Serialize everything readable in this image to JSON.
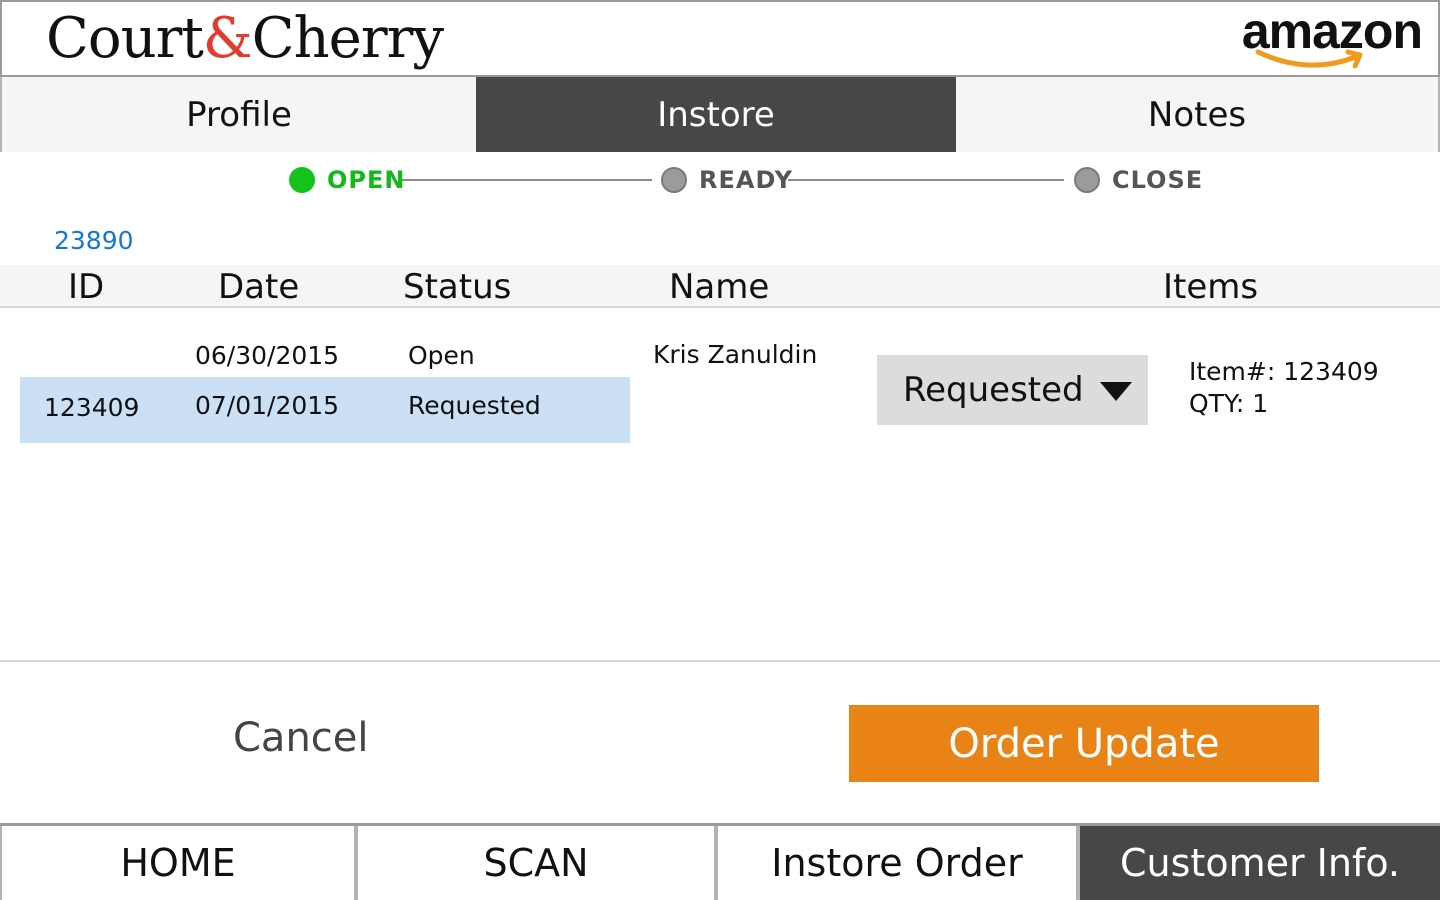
{
  "header": {
    "brand_left": "Court",
    "brand_amp": "&",
    "brand_right": "Cherry",
    "partner_logo": "amazon"
  },
  "tabs": [
    {
      "label": "Profile",
      "active": false
    },
    {
      "label": "Instore",
      "active": true
    },
    {
      "label": "Notes",
      "active": false
    }
  ],
  "progress": {
    "steps": [
      {
        "label": "OPEN",
        "state": "active",
        "color": "#13c21a"
      },
      {
        "label": "READY",
        "state": "inactive",
        "color": "#9b9b9b"
      },
      {
        "label": "CLOSE",
        "state": "inactive",
        "color": "#9b9b9b"
      }
    ]
  },
  "order_number": "23890",
  "table": {
    "headers": [
      "ID",
      "Date",
      "Status",
      "Name",
      "Items"
    ],
    "rows": [
      {
        "id": "",
        "date": "06/30/2015",
        "status": "Open",
        "selected": false
      },
      {
        "id": "123409",
        "date": "07/01/2015",
        "status": "Requested",
        "selected": true
      }
    ],
    "customer_name": "Kris Zanuldin",
    "status_dropdown": {
      "value": "Requested"
    },
    "item": {
      "number_line": "Item#: 123409",
      "qty_line": "QTY: 1"
    }
  },
  "actions": {
    "cancel": "Cancel",
    "order_update": "Order Update"
  },
  "bottom_nav": [
    {
      "label": "HOME",
      "active": false
    },
    {
      "label": "SCAN",
      "active": false
    },
    {
      "label": "Instore Order",
      "active": false
    },
    {
      "label": "Customer Info.",
      "active": true
    }
  ],
  "colors": {
    "accent_orange": "#ea8316",
    "active_tab": "#474747",
    "selected_row": "#cce0f5",
    "link_blue": "#1478d4"
  }
}
